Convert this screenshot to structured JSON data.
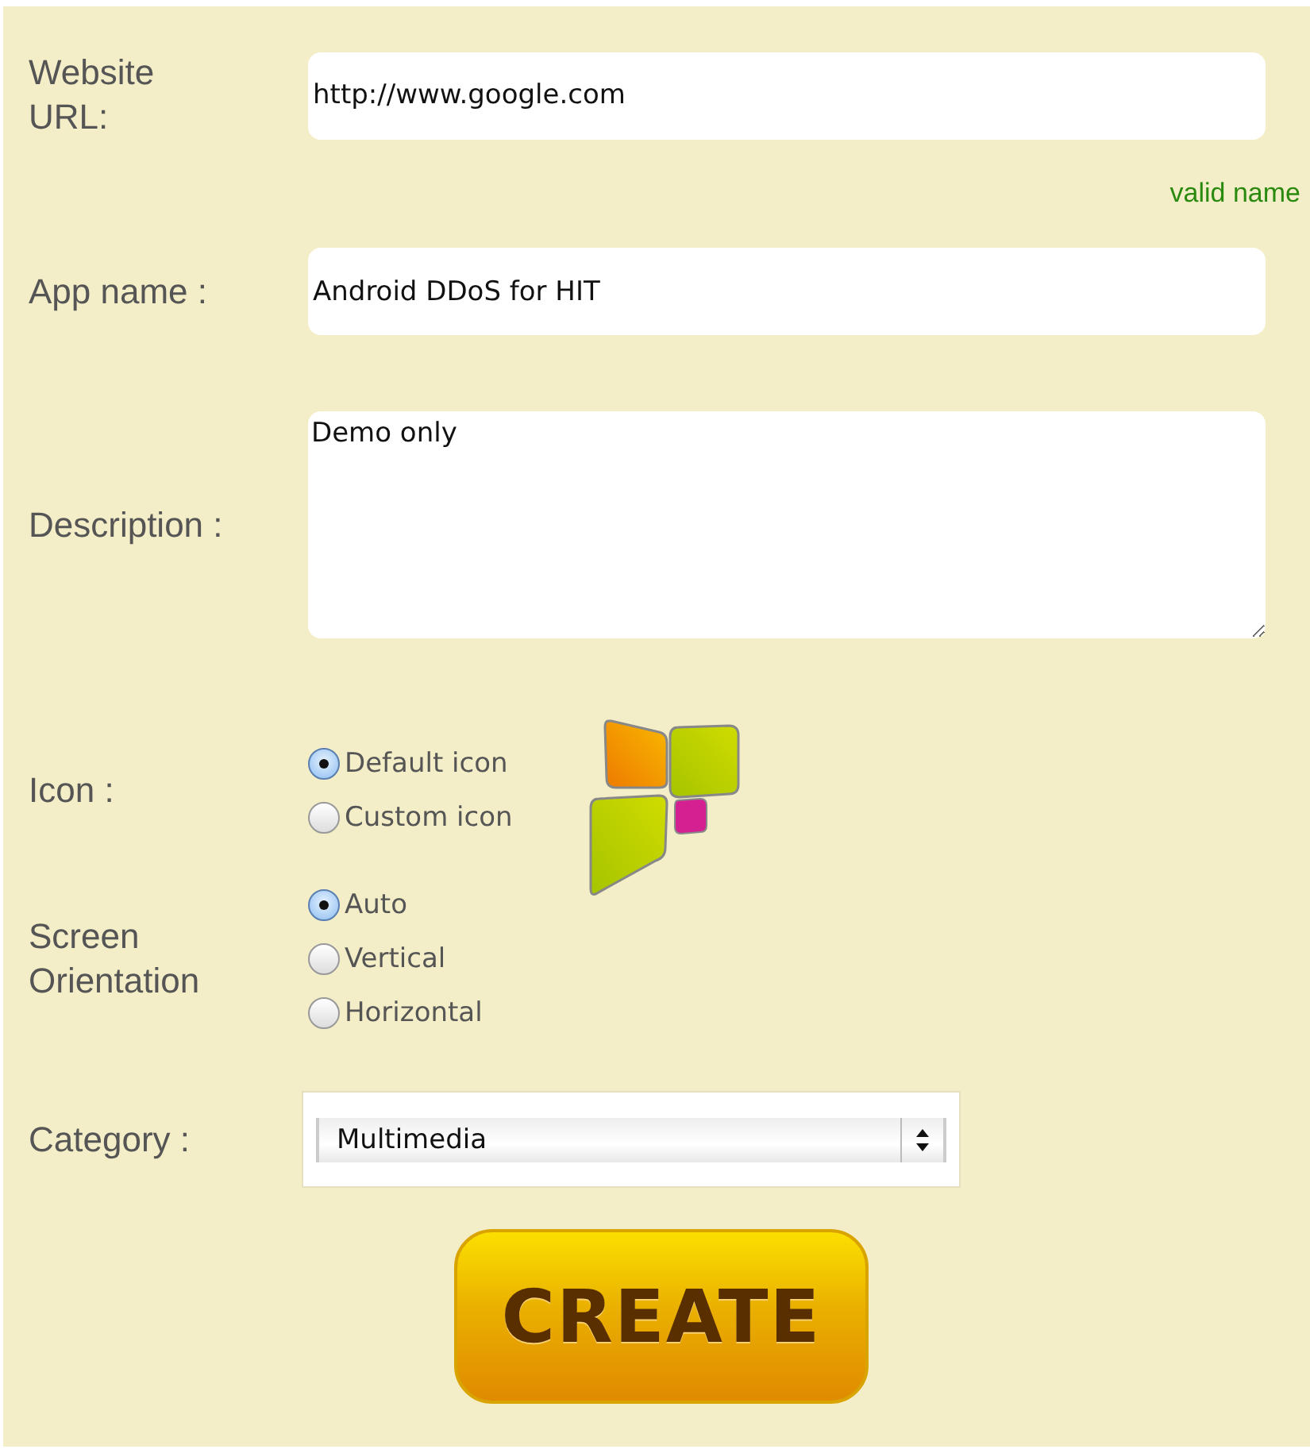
{
  "url": {
    "label": "Website URL:",
    "value": "http://www.google.com",
    "validation": "valid name"
  },
  "app_name": {
    "label": "App name :",
    "value": "Android DDoS for HIT"
  },
  "description": {
    "label": "Description :",
    "value": "Demo only"
  },
  "icon": {
    "label": "Icon :",
    "options": [
      {
        "label": "Default icon",
        "selected": true
      },
      {
        "label": "Custom icon",
        "selected": false
      }
    ]
  },
  "orientation": {
    "label": "Screen Orientation",
    "options": [
      {
        "label": "Auto",
        "selected": true
      },
      {
        "label": "Vertical",
        "selected": false
      },
      {
        "label": "Horizontal",
        "selected": false
      }
    ]
  },
  "category": {
    "label": "Category :",
    "value": "Multimedia"
  },
  "create_button": {
    "label": "CREATE"
  }
}
